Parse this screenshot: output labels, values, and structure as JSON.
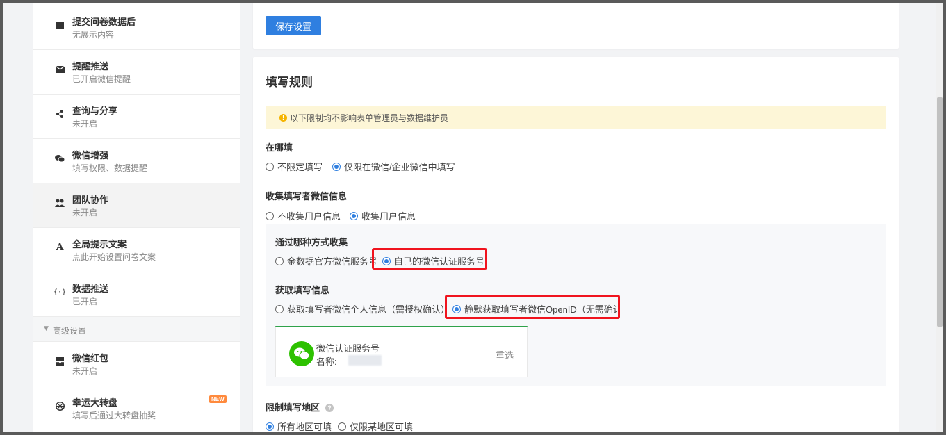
{
  "sidebar": {
    "items": [
      {
        "title": "提交问卷数据后",
        "sub": "无展示内容",
        "icon": "square-icon"
      },
      {
        "title": "提醒推送",
        "sub": "已开启微信提醒",
        "icon": "envelope-icon"
      },
      {
        "title": "查询与分享",
        "sub": "未开启",
        "icon": "share-icon"
      },
      {
        "title": "微信增强",
        "sub": "填写权限、数据提醒",
        "icon": "wechat-icon"
      },
      {
        "title": "团队协作",
        "sub": "未开启",
        "icon": "users-icon"
      },
      {
        "title": "全局提示文案",
        "sub": "点此开始设置问卷文案",
        "icon": "font-icon"
      },
      {
        "title": "数据推送",
        "sub": "已开启",
        "icon": "code-icon"
      }
    ],
    "advanced_label": "高级设置",
    "advanced_items": [
      {
        "title": "微信红包",
        "sub": "未开启",
        "icon": "gift-icon"
      },
      {
        "title": "幸运大转盘",
        "sub": "填写后通过大转盘抽奖",
        "icon": "wheel-icon",
        "badge": "NEW"
      }
    ]
  },
  "toolbar": {
    "save_label": "保存设置"
  },
  "rules": {
    "title": "填写规则",
    "notice": "以下限制均不影响表单管理员与数据维护员",
    "where": {
      "label": "在哪填",
      "options": [
        "不限定填写",
        "仅限在微信/企业微信中填写"
      ],
      "selected": 1
    },
    "collect": {
      "label": "收集填写者微信信息",
      "options": [
        "不收集用户信息",
        "收集用户信息"
      ],
      "selected": 1
    },
    "method": {
      "label": "通过哪种方式收集",
      "options": [
        "金数据官方微信服务号",
        "自己的微信认证服务号"
      ],
      "selected": 1
    },
    "fetch": {
      "label": "获取填写信息",
      "options": [
        "获取填写者微信个人信息（需授权确认）",
        "静默获取填写者微信OpenID（无需确认"
      ],
      "selected": 1
    },
    "account_card": {
      "title": "微信认证服务号",
      "name_label": "名称:",
      "reselect": "重选"
    },
    "region": {
      "label": "限制填写地区",
      "options": [
        "所有地区可填",
        "仅限某地区可填"
      ],
      "selected": 0
    }
  },
  "colors": {
    "primary": "#2f7fe0",
    "highlight": "#f0141e",
    "notice_bg": "#fdf6d7",
    "wechat": "#2dc100"
  }
}
